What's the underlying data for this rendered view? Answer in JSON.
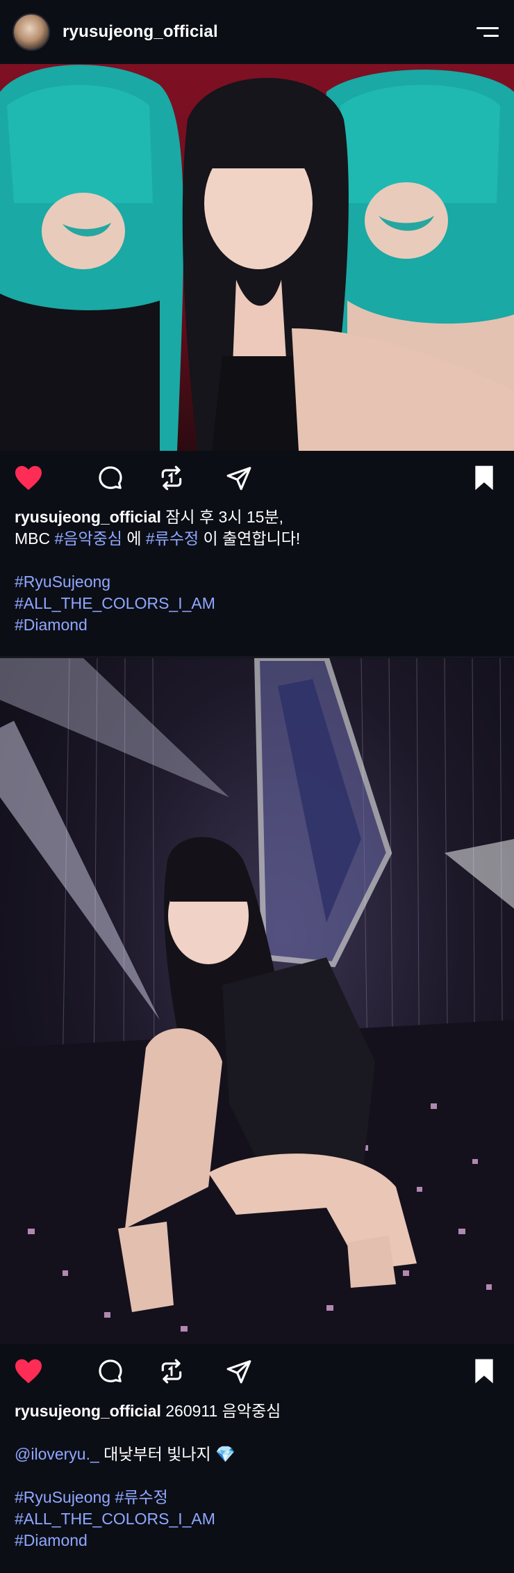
{
  "profile": {
    "username": "ryusujeong_official"
  },
  "posts": [
    {
      "username": "ryusujeong_official",
      "caption_line1": "잠시 후 3시 15분,",
      "caption_line2_prefix": "MBC ",
      "caption_line2_tag1": "#음악중심",
      "caption_line2_mid": " 에 ",
      "caption_line2_tag2": "#류수정",
      "caption_line2_suffix": " 이 출연합니다!",
      "hashtag1": "#RyuSujeong",
      "hashtag2": "#ALL_THE_COLORS_I_AM",
      "hashtag3": "#Diamond",
      "liked": true,
      "saved": true
    },
    {
      "username": "ryusujeong_official",
      "caption_line1": "260911 음악중심",
      "mention": "@iloveryu._",
      "mention_text": " 대낮부터 빛나지 ",
      "emoji": "💎",
      "hashtag1": "#RyuSujeong",
      "hashtag1b": "#류수정",
      "hashtag2": "#ALL_THE_COLORS_I_AM",
      "hashtag3": "#Diamond",
      "liked": true,
      "saved": true
    }
  ],
  "icons": {
    "heart": "heart-icon",
    "comment": "comment-icon",
    "repost": "repost-icon",
    "share": "share-icon",
    "bookmark": "bookmark-icon",
    "menu": "menu-icon"
  },
  "colors": {
    "background": "#0c0e16",
    "like": "#ff2d55",
    "hashtag": "#8fa8ff"
  }
}
